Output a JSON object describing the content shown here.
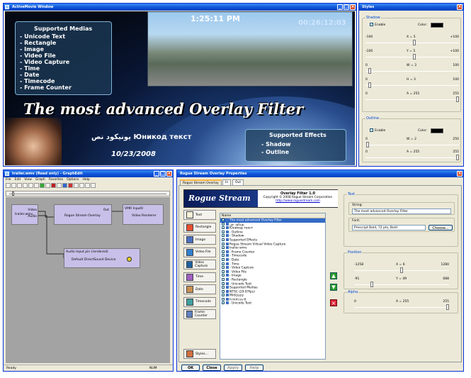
{
  "movie": {
    "title": "ActiveMovie Window",
    "clock": "1:25:11 PM",
    "timecode": "00:26:12:03",
    "medias_title": "Supported Medias",
    "medias": [
      "- Unicode Text",
      "- Rectangle",
      "- Image",
      "- Video File",
      "- Video Capture",
      "- Time",
      "- Date",
      "- Timecode",
      "- Frame Counter"
    ],
    "headline": "The most advanced Overlay Filter",
    "unicode": "یونیکود نص   Юникод текст",
    "date": "10/23/2008",
    "effects_title": "Supported Effects",
    "effects": [
      "- Shadow",
      "- Outline"
    ]
  },
  "styles": {
    "title": "Styles",
    "shadow": {
      "label": "Shadow",
      "enable": "Enable",
      "color": "Color:",
      "x": {
        "min": "-100",
        "label": "X = 5",
        "max": "+100",
        "value": 5,
        "lo": -100,
        "hi": 100
      },
      "y": {
        "min": "-100",
        "label": "Y = 5",
        "max": "+100",
        "value": 5,
        "lo": -100,
        "hi": 100
      },
      "w": {
        "min": "0",
        "label": "W = 3",
        "max": "100",
        "value": 3,
        "lo": 0,
        "hi": 100
      },
      "h": {
        "min": "0",
        "label": "H = 3",
        "max": "100",
        "value": 3,
        "lo": 0,
        "hi": 100
      },
      "a": {
        "min": "0",
        "label": "A = 255",
        "max": "255",
        "value": 255,
        "lo": 0,
        "hi": 255
      }
    },
    "outline": {
      "label": "Outline",
      "enable": "Enable",
      "color": "Color:",
      "w": {
        "min": "0",
        "label": "W = 2",
        "max": "250",
        "value": 2,
        "lo": 0,
        "hi": 250
      },
      "a": {
        "min": "0",
        "label": "A = 255",
        "max": "255",
        "value": 255,
        "lo": 0,
        "hi": 255
      }
    }
  },
  "graph": {
    "title": "trailer.wmv (Read only) - GraphEdit",
    "menu": [
      "File",
      "Edit",
      "View",
      "Graph",
      "Favorites",
      "Options",
      "Help"
    ],
    "nodes": {
      "src": "trailer.wmv",
      "src_video": "Video",
      "src_audio": "Audio",
      "overlay": "Rogue Stream Overlay",
      "out": "Out",
      "vmr_in": "VMR Input0",
      "renderer": "Video Renderer",
      "audio_in": "Audio Input pin (rendered)",
      "dsound": "Default DirectSound Device"
    },
    "status_left": "Ready",
    "status_right": "NUM"
  },
  "props": {
    "title": "Rogue Stream Overlay Properties",
    "tabs": [
      "Rogue Stream Overlay",
      "In",
      "Out"
    ],
    "logo": "Rogue Stream",
    "about": [
      "Overlay Filter 1.0",
      "Copyright © 2008 Rogue Stream Corporation",
      "http://www.roguestream.com"
    ],
    "buttons": [
      "Text",
      "Rectangle",
      "Image",
      "Video File",
      "Video Capture",
      "Time",
      "Date",
      "Timecode",
      "Frame Counter"
    ],
    "styles_btn": "Styles...",
    "name_header": "Name",
    "items": [
      "The most advanced Overlay Filter",
      "یونیکود نص",
      "Юникод текст",
      "- Outline",
      "- Shadow",
      "Supported Effects",
      "Rogue Stream Virtual Video Capture",
      "trailer.wmv",
      "- Frame Counter",
      "- Timecode",
      "- Date",
      "- Time",
      "- Video Capture",
      "- Video File",
      "- Image",
      "- Rectangle",
      "- Unicode Text",
      "Supported Medias",
      "NTSC (29.97fps)",
      "M/d/yyyy",
      "h:mm:ss tt",
      "- Unicode Text"
    ],
    "text_group": "Text",
    "string_label": "String:",
    "string_value": "The most advanced Overlay Filter",
    "font_label": "Font:",
    "font_value": "Prescript Bold, 72 pts, Bold",
    "font_btn": "Choose...",
    "pos_group": "Position",
    "x": {
      "min": "-1258",
      "label": "X = 6",
      "max": "1280",
      "value": 6,
      "lo": -1258,
      "hi": 1280
    },
    "y": {
      "min": "-91",
      "label": "Y = 49",
      "max": "688",
      "value": 49,
      "lo": -91,
      "hi": 688
    },
    "alpha_group": "Alpha",
    "alpha": {
      "min": "0",
      "label": "A = 255",
      "max": "255",
      "value": 255,
      "lo": 0,
      "hi": 255
    },
    "bottom": [
      "OK",
      "Close",
      "Apply",
      "Help"
    ]
  }
}
